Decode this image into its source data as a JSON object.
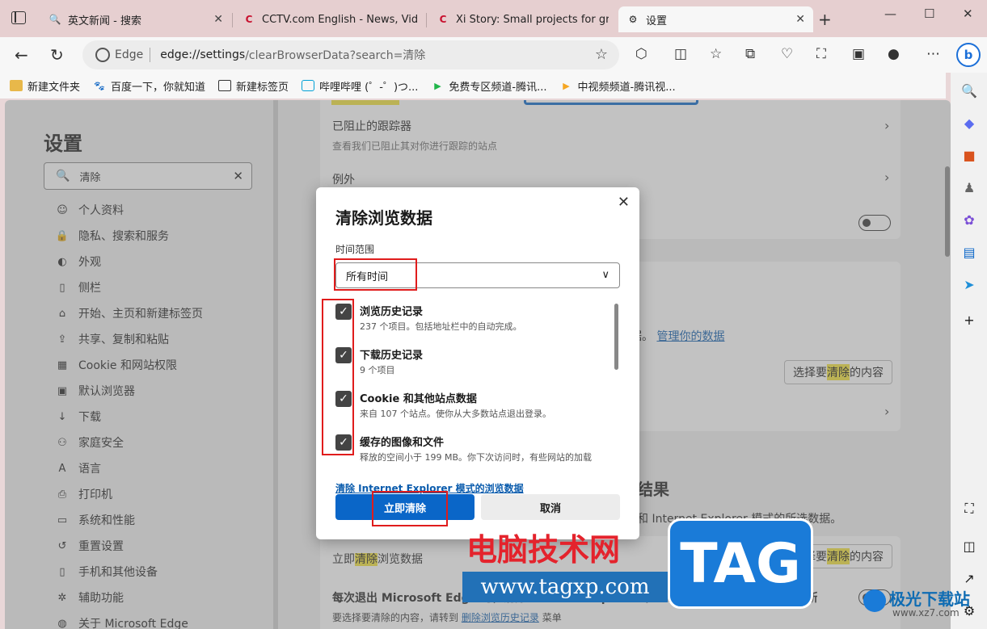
{
  "tabs": [
    {
      "label": "英文新闻 - 搜索",
      "favicon": "search-icon"
    },
    {
      "label": "CCTV.com English - News, Video",
      "favicon": "cctv-icon"
    },
    {
      "label": "Xi Story: Small projects for greate",
      "favicon": "cctv-icon"
    },
    {
      "label": "设置",
      "favicon": "gear-icon",
      "active": true
    }
  ],
  "window": {
    "minimize": "—",
    "maximize": "☐",
    "close": "✕",
    "new_tab": "+"
  },
  "address": {
    "brand": "Edge",
    "url_host": "edge://settings",
    "url_path": "/clearBrowserData?search=清除"
  },
  "favorites": [
    {
      "label": "新建文件夹",
      "icon": "folder-icon"
    },
    {
      "label": "百度一下，你就知道",
      "icon": "baidu-icon"
    },
    {
      "label": "新建标签页",
      "icon": "newtab-icon"
    },
    {
      "label": "哔哩哔哩 (゜-゜)つ...",
      "icon": "bilibili-icon"
    },
    {
      "label": "免费专区频道-腾讯...",
      "icon": "video-icon"
    },
    {
      "label": "中视频频道-腾讯视...",
      "icon": "video-icon"
    }
  ],
  "settings": {
    "title": "设置",
    "search_value": "清除",
    "nav": [
      {
        "label": "个人资料",
        "icon": "profile-icon"
      },
      {
        "label": "隐私、搜索和服务",
        "icon": "lock-icon"
      },
      {
        "label": "外观",
        "icon": "palette-icon"
      },
      {
        "label": "侧栏",
        "icon": "sidebar-icon"
      },
      {
        "label": "开始、主页和新建标签页",
        "icon": "home-icon"
      },
      {
        "label": "共享、复制和粘贴",
        "icon": "share-icon"
      },
      {
        "label": "Cookie 和网站权限",
        "icon": "cookie-icon"
      },
      {
        "label": "默认浏览器",
        "icon": "browser-icon"
      },
      {
        "label": "下载",
        "icon": "download-icon"
      },
      {
        "label": "家庭安全",
        "icon": "family-icon"
      },
      {
        "label": "语言",
        "icon": "language-icon"
      },
      {
        "label": "打印机",
        "icon": "printer-icon"
      },
      {
        "label": "系统和性能",
        "icon": "system-icon"
      },
      {
        "label": "重置设置",
        "icon": "reset-icon"
      },
      {
        "label": "手机和其他设备",
        "icon": "phone-icon"
      },
      {
        "label": "辅助功能",
        "icon": "accessibility-icon"
      },
      {
        "label": "关于 Microsoft Edge",
        "icon": "edge-icon"
      }
    ]
  },
  "background": {
    "blocked_trackers_title": "已阻止的跟踪器",
    "blocked_trackers_sub": "查看我们已阻止其对你进行跟踪的站点",
    "exceptions_title": "例外",
    "data_text": "数据。",
    "manage_data_link": "管理你的数据",
    "choose_clear_pre": "选择要",
    "choose_clear_hl": "清除",
    "choose_clear_post": "的内容",
    "result_heading": "结果",
    "ie_mode_text": "和 Internet Explorer 模式的所选数据。",
    "clear_now_pre": "立即",
    "clear_now_hl": "清除",
    "clear_now_post": "浏览数据",
    "on_exit_title": "每次退出 Microsoft Edge 时，清除 Internet Explorer 和 Internet Explorer 模式的所选数据",
    "on_exit_sub_pre": "要选择要清除的内容，请转到",
    "on_exit_sub_link": "删除浏览历史记录",
    "on_exit_sub_post": "菜单"
  },
  "dialog": {
    "title": "清除浏览数据",
    "time_range_label": "时间范围",
    "time_range_value": "所有时间",
    "items": [
      {
        "title": "浏览历史记录",
        "sub": "237 个项目。包括地址栏中的自动完成。",
        "checked": true
      },
      {
        "title": "下载历史记录",
        "sub": "9 个项目",
        "checked": true
      },
      {
        "title": "Cookie 和其他站点数据",
        "sub": "来自 107 个站点。使你从大多数站点退出登录。",
        "checked": true
      },
      {
        "title": "缓存的图像和文件",
        "sub": "释放的空间小于 199 MB。你下次访问时，有些网站的加载",
        "checked": true
      }
    ],
    "ie_link": "清除 Internet Explorer 模式的浏览数据",
    "clear_button": "立即清除",
    "cancel_button": "取消"
  },
  "watermark": {
    "text": "电脑技术网",
    "url": "www.tagxp.com",
    "tag": "TAG",
    "site_name": "极光下载站",
    "site_url": "www.xz7.com"
  },
  "colors": {
    "accent": "#0a66c8",
    "highlight": "#f2e23a",
    "annotation": "#e01c1c"
  }
}
